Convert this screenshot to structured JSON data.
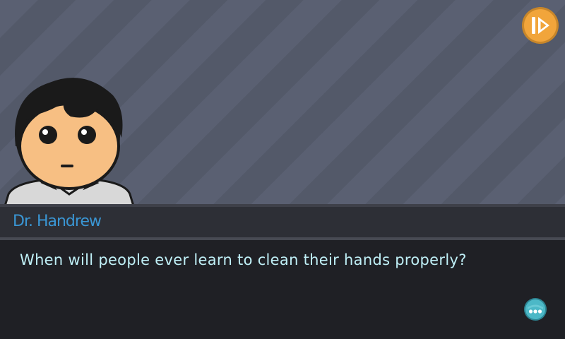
{
  "dialog": {
    "speaker": "Dr. Handrew",
    "text": "When will people ever learn to clean their hands properly?"
  },
  "icons": {
    "skip": "skip-forward-icon",
    "continue": "more-dots-icon",
    "portrait": "character-portrait"
  },
  "colors": {
    "skip_button": "#f1a53b",
    "speaker_name": "#3a96d4",
    "dialog_text": "#bfeff6",
    "continue_button": "#4cb8c7"
  }
}
